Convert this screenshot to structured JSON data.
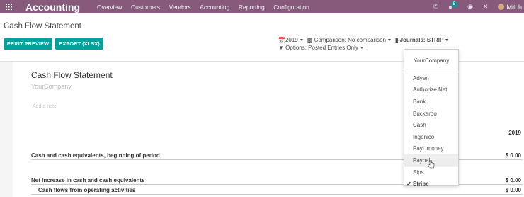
{
  "navbar": {
    "app_title": "Accounting",
    "menu": [
      "Overview",
      "Customers",
      "Vendors",
      "Accounting",
      "Reporting",
      "Configuration"
    ],
    "message_count": "5",
    "user_name": "Mitch"
  },
  "control_panel": {
    "page_title": "Cash Flow Statement",
    "print_preview_label": "PRINT PREVIEW",
    "export_label": "EXPORT (XLSX)",
    "date_filter": "2019",
    "comparison_filter": "Comparison: No comparison",
    "journals_filter": "Journals: STRIP",
    "options_filter": "Options: Posted Entries Only"
  },
  "report": {
    "title": "Cash Flow Statement",
    "company": "YourCompany",
    "note_placeholder": "Add a note",
    "year_header": "2019",
    "rows": [
      {
        "label": "Cash and cash equivalents, beginning of period",
        "amount": "$ 0.00"
      },
      {
        "label": "Net increase in cash and cash equivalents",
        "amount": "$ 0.00"
      },
      {
        "label": "Cash flows from operating activities",
        "amount": "$ 0.00"
      }
    ]
  },
  "journals_dropdown": {
    "company_header": "YourCompany",
    "items": [
      {
        "label": "Adyen",
        "checked": false
      },
      {
        "label": "Authorize.Net",
        "checked": false
      },
      {
        "label": "Bank",
        "checked": false
      },
      {
        "label": "Buckaroo",
        "checked": false
      },
      {
        "label": "Cash",
        "checked": false
      },
      {
        "label": "Ingenico",
        "checked": false
      },
      {
        "label": "PayUmoney",
        "checked": false
      },
      {
        "label": "Paypal",
        "checked": false
      },
      {
        "label": "Sips",
        "checked": false
      },
      {
        "label": "Stripe",
        "checked": true
      }
    ],
    "hovered_item": "Paypal"
  },
  "colors": {
    "navbar": "#875a7b",
    "primary_button": "#00a09d"
  },
  "icons": [
    "apps-grid-icon",
    "phone-icon",
    "chat-icon",
    "speech-bubble-icon",
    "close-icon",
    "calendar-icon",
    "bar-chart-icon",
    "book-icon",
    "filter-icon",
    "check-icon"
  ]
}
